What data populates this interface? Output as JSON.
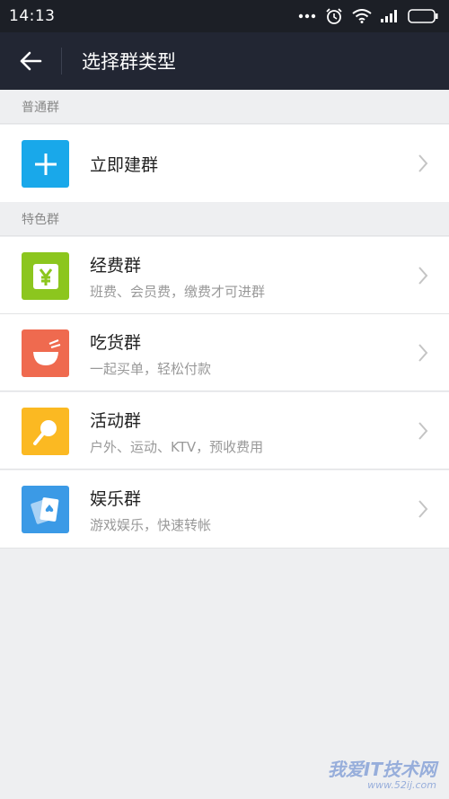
{
  "status_bar": {
    "time": "14:13"
  },
  "header": {
    "title": "选择群类型"
  },
  "sections": [
    {
      "title": "普通群"
    },
    {
      "title": "特色群"
    }
  ],
  "rows": [
    {
      "title": "立即建群",
      "subtitle": "",
      "icon": "plus-icon",
      "color": "#19a8ea"
    },
    {
      "title": "经费群",
      "subtitle": "班费、会员费，缴费才可进群",
      "icon": "yen-icon",
      "color": "#8cc61e"
    },
    {
      "title": "吃货群",
      "subtitle": "一起买单，轻松付款",
      "icon": "bowl-icon",
      "color": "#ef6a4f"
    },
    {
      "title": "活动群",
      "subtitle": "户外、运动、KTV，预收费用",
      "icon": "ping-pong-icon",
      "color": "#fbb922"
    },
    {
      "title": "娱乐群",
      "subtitle": "游戏娱乐，快速转帐",
      "icon": "playing-cards-icon",
      "color": "#3b9ae6"
    }
  ],
  "watermark": {
    "text": "我爱IT技术网",
    "url": "www.52ij.com"
  }
}
